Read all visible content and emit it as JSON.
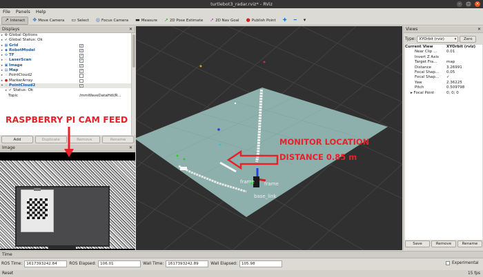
{
  "window": {
    "title": "turtlebot3_radar.rviz* - RViz"
  },
  "menu": [
    "File",
    "Panels",
    "Help"
  ],
  "toolbar": [
    {
      "label": "Interact",
      "icon": "interact-icon",
      "active": true
    },
    {
      "label": "Move Camera",
      "icon": "move-camera-icon"
    },
    {
      "label": "Select",
      "icon": "select-icon"
    },
    {
      "label": "Focus Camera",
      "icon": "focus-camera-icon"
    },
    {
      "label": "Measure",
      "icon": "measure-icon"
    },
    {
      "label": "2D Pose Estimate",
      "icon": "pose-estimate-icon"
    },
    {
      "label": "2D Nav Goal",
      "icon": "nav-goal-icon"
    },
    {
      "label": "Publish Point",
      "icon": "publish-point-icon"
    }
  ],
  "displays": {
    "title": "Displays",
    "items": [
      {
        "label": "Global Options",
        "icon": "gear-icon",
        "blue": false
      },
      {
        "label": "Global Status: Ok",
        "icon": "check-icon",
        "blue": false
      },
      {
        "label": "Grid",
        "icon": "grid-icon",
        "blue": true,
        "checked": true
      },
      {
        "label": "RobotModel",
        "icon": "robot-icon",
        "blue": true,
        "checked": true
      },
      {
        "label": "TF",
        "icon": "tf-icon",
        "blue": true,
        "checked": true
      },
      {
        "label": "LaserScan",
        "icon": "laser-icon",
        "blue": true,
        "checked": true
      },
      {
        "label": "Image",
        "icon": "image-icon",
        "blue": true,
        "checked": true
      },
      {
        "label": "Map",
        "icon": "map-icon",
        "blue": true,
        "checked": true
      },
      {
        "label": "PointCloud2",
        "icon": "pointcloud-icon",
        "blue": false,
        "checked": false
      },
      {
        "label": "MarkerArray",
        "icon": "marker-icon",
        "blue": false,
        "checked": false
      },
      {
        "label": "PointCloud2",
        "icon": "pointcloud-icon",
        "blue": true,
        "checked": true
      },
      {
        "label": "Status: Ok",
        "icon": "check-icon",
        "blue": false
      },
      {
        "label": "Topic",
        "icon": "",
        "blue": false,
        "value": "/mmWaveDataHdl/R..."
      }
    ],
    "buttons": {
      "add": "Add",
      "duplicate": "Duplicate",
      "remove": "Remove",
      "rename": "Rename"
    }
  },
  "image_panel": {
    "title": "Image"
  },
  "views": {
    "title": "Views",
    "type_label": "Type:",
    "type_value": "XYOrbit (rviz)",
    "zero": "Zero",
    "rows": [
      {
        "k": "Current View",
        "v": "XYOrbit (rviz)",
        "head": true
      },
      {
        "k": "Near Clip ...",
        "v": "0.01"
      },
      {
        "k": "Invert Z Axis",
        "v": ""
      },
      {
        "k": "Target Fra...",
        "v": "map"
      },
      {
        "k": "Distance",
        "v": "3.26991"
      },
      {
        "k": "Focal Shap...",
        "v": "0.05"
      },
      {
        "k": "Focal Shap...",
        "v": "✓"
      },
      {
        "k": "Yaw",
        "v": "2.36225"
      },
      {
        "k": "Pitch",
        "v": "0.509798"
      },
      {
        "k": "Focal Point",
        "v": "0; 0; 0"
      }
    ],
    "buttons": {
      "save": "Save",
      "remove": "Remove",
      "rename": "Rename"
    }
  },
  "time": {
    "title": "Time",
    "ros_time_label": "ROS Time:",
    "ros_time": "1617393242.84",
    "ros_elapsed_label": "ROS Elapsed:",
    "ros_elapsed": "106.01",
    "wall_time_label": "Wall Time:",
    "wall_time": "1617393242.89",
    "wall_elapsed_label": "Wall Elapsed:",
    "wall_elapsed": "105.98",
    "experimental": "Experimental"
  },
  "status": {
    "reset": "Reset",
    "fps": "15 fps"
  },
  "annotations": {
    "cam_feed": "RASPBERRY PI CAM FEED",
    "monitor_location": "MONITOR LOCATION",
    "distance": "DISTANCE 0.85 m"
  },
  "scene": {
    "frame_label_1": "frame",
    "frame_label_2": "frame",
    "base_link": "base_link"
  },
  "colors": {
    "annotation": "#e8202a",
    "floor": "#93b7b3",
    "grid": "#3a3a3a",
    "accent": "#e95420"
  }
}
